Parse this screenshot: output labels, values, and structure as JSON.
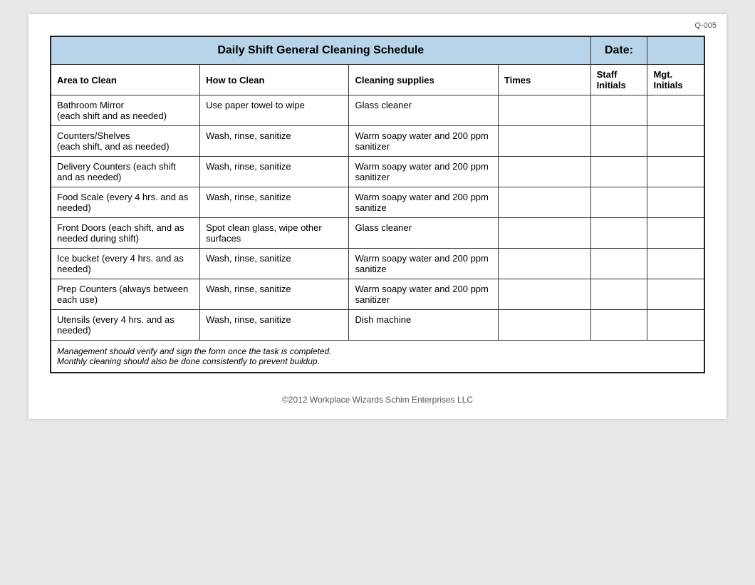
{
  "doc_id": "Q-005",
  "title": "Daily Shift General Cleaning Schedule",
  "date_label": "Date:",
  "columns": {
    "area": "Area to Clean",
    "how": "How to Clean",
    "supplies": "Cleaning supplies",
    "times": "Times",
    "staff": "Staff Initials",
    "mgt": "Mgt. Initials"
  },
  "rows": [
    {
      "area": "Bathroom Mirror\n(each shift and as needed)",
      "how": "Use paper towel to wipe",
      "supplies": "Glass cleaner",
      "times": "",
      "staff": "",
      "mgt": ""
    },
    {
      "area": "Counters/Shelves\n(each shift, and as needed)",
      "how": "Wash, rinse, sanitize",
      "supplies": "Warm soapy water and 200 ppm sanitizer",
      "times": "",
      "staff": "",
      "mgt": ""
    },
    {
      "area": "Delivery Counters (each shift and as needed)",
      "how": "Wash, rinse, sanitize",
      "supplies": "Warm soapy water and 200 ppm sanitizer",
      "times": "",
      "staff": "",
      "mgt": ""
    },
    {
      "area": "Food Scale (every 4 hrs. and as needed)",
      "how": "Wash, rinse, sanitize",
      "supplies": "Warm soapy water and 200 ppm sanitize",
      "times": "",
      "staff": "",
      "mgt": ""
    },
    {
      "area": "Front Doors (each shift, and as needed during shift)",
      "how": "Spot clean glass, wipe other surfaces",
      "supplies": "Glass cleaner",
      "times": "",
      "staff": "",
      "mgt": ""
    },
    {
      "area": "Ice bucket (every 4 hrs. and as needed)",
      "how": "Wash, rinse, sanitize",
      "supplies": "Warm soapy water and 200 ppm sanitize",
      "times": "",
      "staff": "",
      "mgt": ""
    },
    {
      "area": "Prep Counters (always between each use)",
      "how": "Wash, rinse, sanitize",
      "supplies": "Warm soapy water and 200 ppm sanitizer",
      "times": "",
      "staff": "",
      "mgt": ""
    },
    {
      "area": "Utensils (every 4 hrs. and as needed)",
      "how": "Wash, rinse, sanitize",
      "supplies": "Dish machine",
      "times": "",
      "staff": "",
      "mgt": ""
    }
  ],
  "notes": [
    "Management should verify and sign the form once the task is completed.",
    "Monthly cleaning should also be done consistently to prevent buildup."
  ],
  "footer": "©2012 Workplace Wizards Schim Enterprises LLC"
}
